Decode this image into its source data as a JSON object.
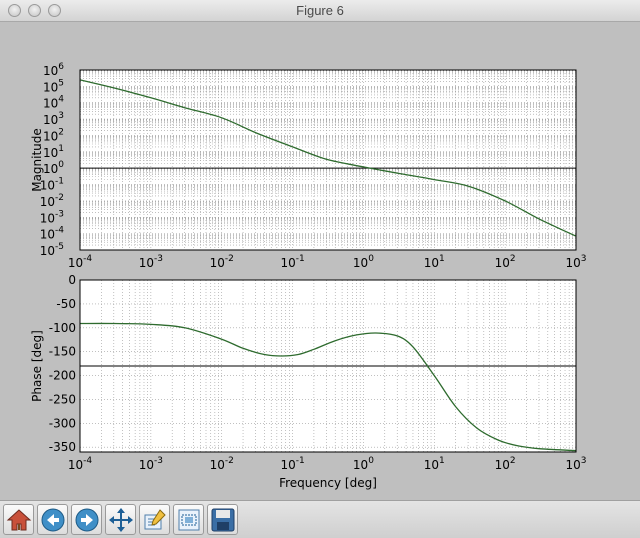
{
  "window": {
    "title": "Figure 6"
  },
  "toolbar": {
    "buttons": [
      "home-icon",
      "back-arrow-icon",
      "forward-arrow-icon",
      "pan-icon",
      "configure-subplots-icon",
      "zoom-rect-icon",
      "save-icon"
    ]
  },
  "colors": {
    "figure_bg": "#bfbfbf",
    "axes_bg": "#ffffff",
    "curve": "#2e6b2e",
    "reference_line": "#000000"
  },
  "chart_data": [
    {
      "type": "line",
      "title": "",
      "xlabel": "",
      "ylabel": "Magnitude",
      "xscale": "log",
      "yscale": "log",
      "xlim": [
        0.0001,
        1000
      ],
      "ylim": [
        1e-05,
        1000000
      ],
      "grid": true,
      "xtick_labels": [
        {
          "base": "10",
          "exp": "-4"
        },
        {
          "base": "10",
          "exp": "-3"
        },
        {
          "base": "10",
          "exp": "-2"
        },
        {
          "base": "10",
          "exp": "-1"
        },
        {
          "base": "10",
          "exp": "0"
        },
        {
          "base": "10",
          "exp": "1"
        },
        {
          "base": "10",
          "exp": "2"
        },
        {
          "base": "10",
          "exp": "3"
        }
      ],
      "ytick_labels": [
        {
          "base": "10",
          "exp": "6"
        },
        {
          "base": "10",
          "exp": "5"
        },
        {
          "base": "10",
          "exp": "4"
        },
        {
          "base": "10",
          "exp": "3"
        },
        {
          "base": "10",
          "exp": "2"
        },
        {
          "base": "10",
          "exp": "1"
        },
        {
          "base": "10",
          "exp": "0"
        },
        {
          "base": "10",
          "exp": "-1"
        },
        {
          "base": "10",
          "exp": "-2"
        },
        {
          "base": "10",
          "exp": "-3"
        },
        {
          "base": "10",
          "exp": "-4"
        },
        {
          "base": "10",
          "exp": "-5"
        }
      ],
      "series": [
        {
          "x": [
            0.0001,
            0.0003,
            0.001,
            0.003,
            0.01,
            0.03,
            0.1,
            0.3,
            1,
            3,
            10,
            30,
            100,
            300,
            1000
          ],
          "y": [
            250000,
            80000,
            20000,
            5000,
            1200,
            150,
            20,
            3.5,
            1.2,
            0.5,
            0.2,
            0.08,
            0.01,
            0.0008,
            7e-05
          ]
        }
      ],
      "hlines": [
        1
      ]
    },
    {
      "type": "line",
      "title": "",
      "xlabel": "Frequency [deg]",
      "ylabel": "Phase [deg]",
      "xscale": "log",
      "xlim": [
        0.0001,
        1000
      ],
      "ylim": [
        -360,
        0
      ],
      "grid": true,
      "xtick_labels": [
        {
          "base": "10",
          "exp": "-4"
        },
        {
          "base": "10",
          "exp": "-3"
        },
        {
          "base": "10",
          "exp": "-2"
        },
        {
          "base": "10",
          "exp": "-1"
        },
        {
          "base": "10",
          "exp": "0"
        },
        {
          "base": "10",
          "exp": "1"
        },
        {
          "base": "10",
          "exp": "2"
        },
        {
          "base": "10",
          "exp": "3"
        }
      ],
      "ytick_labels": [
        "0",
        "-50",
        "-100",
        "-150",
        "-200",
        "-250",
        "-300",
        "-350"
      ],
      "ytick_values": [
        0,
        -50,
        -100,
        -150,
        -200,
        -250,
        -300,
        -350
      ],
      "series": [
        {
          "x": [
            0.0001,
            0.0003,
            0.001,
            0.003,
            0.01,
            0.02,
            0.04,
            0.07,
            0.12,
            0.2,
            0.4,
            0.8,
            1.5,
            3,
            5,
            10,
            20,
            40,
            80,
            150,
            300,
            1000
          ],
          "y": [
            -91,
            -91,
            -93,
            -100,
            -124,
            -143,
            -156,
            -159,
            -156,
            -145,
            -127,
            -115,
            -111,
            -117,
            -140,
            -200,
            -265,
            -310,
            -335,
            -347,
            -353,
            -357
          ]
        }
      ],
      "hlines": [
        -180
      ]
    }
  ]
}
